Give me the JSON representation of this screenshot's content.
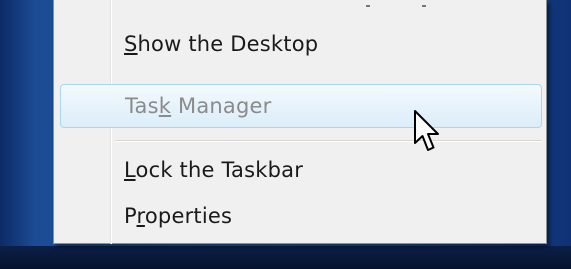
{
  "context_menu": {
    "items": [
      {
        "label_before": "",
        "accel": "S",
        "label_after": "how the Desktop",
        "enabled": true
      },
      {
        "label_before": "Tas",
        "accel": "k",
        "label_after": " Manager",
        "enabled": false
      },
      {
        "label_before": "",
        "accel": "L",
        "label_after": "ock the Taskbar",
        "enabled": true
      },
      {
        "label_before": "P",
        "accel": "r",
        "label_after": "operties",
        "enabled": true
      }
    ]
  },
  "icons": {
    "cursor": "arrow-cursor-icon"
  }
}
